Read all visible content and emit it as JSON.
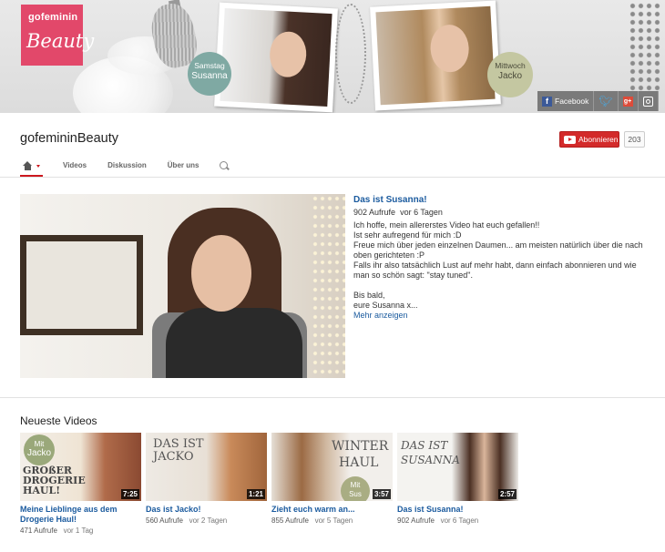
{
  "banner": {
    "logo_top": "gofeminin",
    "logo_bottom": "Beauty",
    "tag1": {
      "day": "Samstag",
      "name": "Susanna"
    },
    "tag2": {
      "day": "Mittwoch",
      "name": "Jacko"
    },
    "social": {
      "facebook_label": "Facebook"
    }
  },
  "channel": {
    "name": "gofemininBeauty",
    "subscribe_label": "Abonnieren",
    "subscriber_count": "203"
  },
  "tabs": [
    {
      "label": "Videos"
    },
    {
      "label": "Diskussion"
    },
    {
      "label": "Über uns"
    }
  ],
  "featured": {
    "title": "Das ist Susanna!",
    "views": "902 Aufrufe",
    "age": "vor 6 Tagen",
    "description": "Ich hoffe, mein allererstes Video hat euch gefallen!!\nIst sehr aufregend für mich :D\nFreue mich über jeden einzelnen Daumen... am meisten natürlich über die nach oben gerichteten :P\nFalls ihr also tatsächlich Lust auf mehr habt, dann einfach abonnieren und wie man so schön sagt: \"stay tuned\".\n\nBis bald,\neure Susanna x...",
    "more_label": "Mehr anzeigen"
  },
  "newest": {
    "title": "Neueste Videos",
    "videos": [
      {
        "title": "Meine Lieblinge aus dem Drogerie Haul!",
        "views": "471 Aufrufe",
        "age": "vor 1 Tag",
        "duration": "7:25",
        "thumb_text": [
          "Mit",
          "Jacko",
          "GROßER",
          "DROGERIE",
          "HAUL!"
        ]
      },
      {
        "title": "Das ist Jacko!",
        "views": "560 Aufrufe",
        "age": "vor 2 Tagen",
        "duration": "1:21",
        "thumb_text": [
          "DAS IST",
          "JACKO"
        ]
      },
      {
        "title": "Zieht euch warm an...",
        "views": "855 Aufrufe",
        "age": "vor 5 Tagen",
        "duration": "3:57",
        "thumb_text": [
          "WINTER",
          "HAUL",
          "Mit",
          "Sus"
        ]
      },
      {
        "title": "Das ist Susanna!",
        "views": "902 Aufrufe",
        "age": "vor 6 Tagen",
        "duration": "2:57",
        "thumb_text": [
          "DAS IST",
          "SUSANNA"
        ]
      }
    ]
  },
  "colors": {
    "logo_pink": "#e2486a",
    "subscribe_red": "#d32a2a",
    "link_blue": "#1a5a9e",
    "tab_active_red": "#cc181e"
  },
  "icons": [
    "home-icon",
    "chevron-down-icon",
    "search-icon",
    "facebook-icon",
    "twitter-icon",
    "googleplus-icon",
    "instagram-icon",
    "youtube-icon"
  ]
}
